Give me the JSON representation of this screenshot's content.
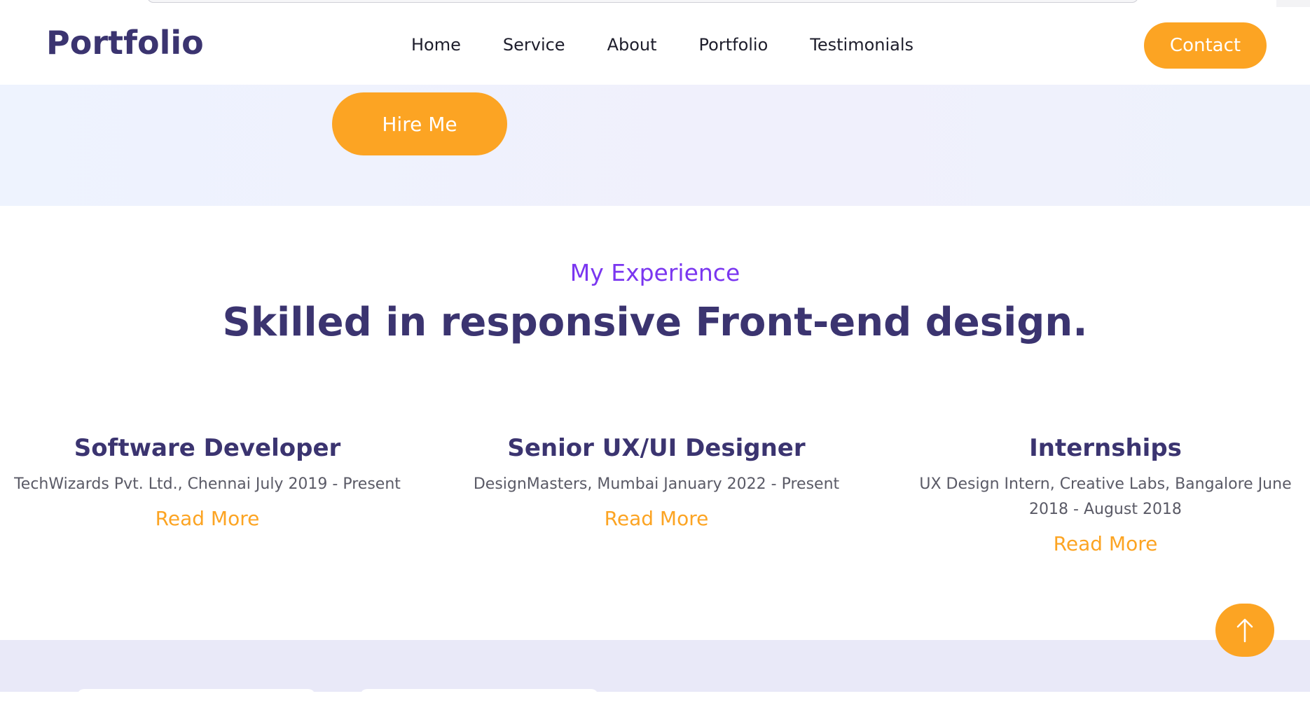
{
  "header": {
    "logo": "Portfolio",
    "nav": [
      "Home",
      "Service",
      "About",
      "Portfolio",
      "Testimonials"
    ],
    "contact_label": "Contact"
  },
  "hero": {
    "hire_label": "Hire Me"
  },
  "experience": {
    "kicker": "My Experience",
    "heading": "Skilled in responsive Front-end design.",
    "cards": [
      {
        "title": "Software Developer",
        "description": "TechWizards Pvt. Ltd., Chennai July 2019 - Present",
        "link": "Read More"
      },
      {
        "title": "Senior UX/UI Designer",
        "description": "DesignMasters, Mumbai January 2022 - Present",
        "link": "Read More"
      },
      {
        "title": "Internships",
        "description": "UX Design Intern, Creative Labs, Bangalore June 2018 - August 2018",
        "link": "Read More"
      }
    ]
  },
  "icons": {
    "scroll_top": "arrow-up-icon"
  },
  "colors": {
    "accent": "#fca423",
    "heading": "#3b3470",
    "kicker": "#7a36f0",
    "body_text": "#5a5a66"
  }
}
